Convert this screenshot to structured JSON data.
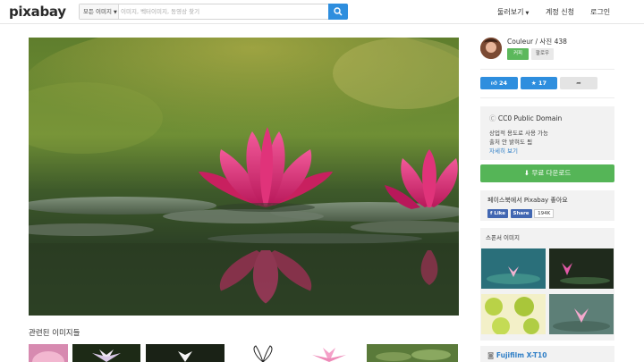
{
  "header": {
    "logo": "pixabay",
    "search_category": "모든 이미지",
    "search_placeholder": "이미지, 벡터이미지, 동영상 찾기",
    "nav": [
      {
        "label": "둘러보기",
        "has_dropdown": true
      },
      {
        "label": "계정 신청",
        "has_dropdown": false
      },
      {
        "label": "로그인",
        "has_dropdown": false
      }
    ]
  },
  "main": {
    "related_title": "관련된 이미지들"
  },
  "sidebar": {
    "user_line": "Couleur / 사진 438",
    "follow_label": "커피",
    "coffee_label": "팔로우",
    "likes": "24",
    "favorites": "17",
    "license": {
      "title": "CC0 Public Domain",
      "line1": "상업적 용도로 사용 가능",
      "line2": "출처 안 밝혀도 됨",
      "link": "자세히 보기"
    },
    "download_label": "무료 다운로드",
    "facebook": {
      "title": "페이스북에서 Pixabay 좋아요",
      "like_label": "Like",
      "share_label": "Share",
      "count": "194K"
    },
    "sponsor_title": "스폰서 이미지",
    "camera": "Fujifilm X-T10"
  },
  "colors": {
    "accent_blue": "#2e8ede",
    "download_green": "#55b557",
    "facebook_blue": "#4267b2"
  }
}
